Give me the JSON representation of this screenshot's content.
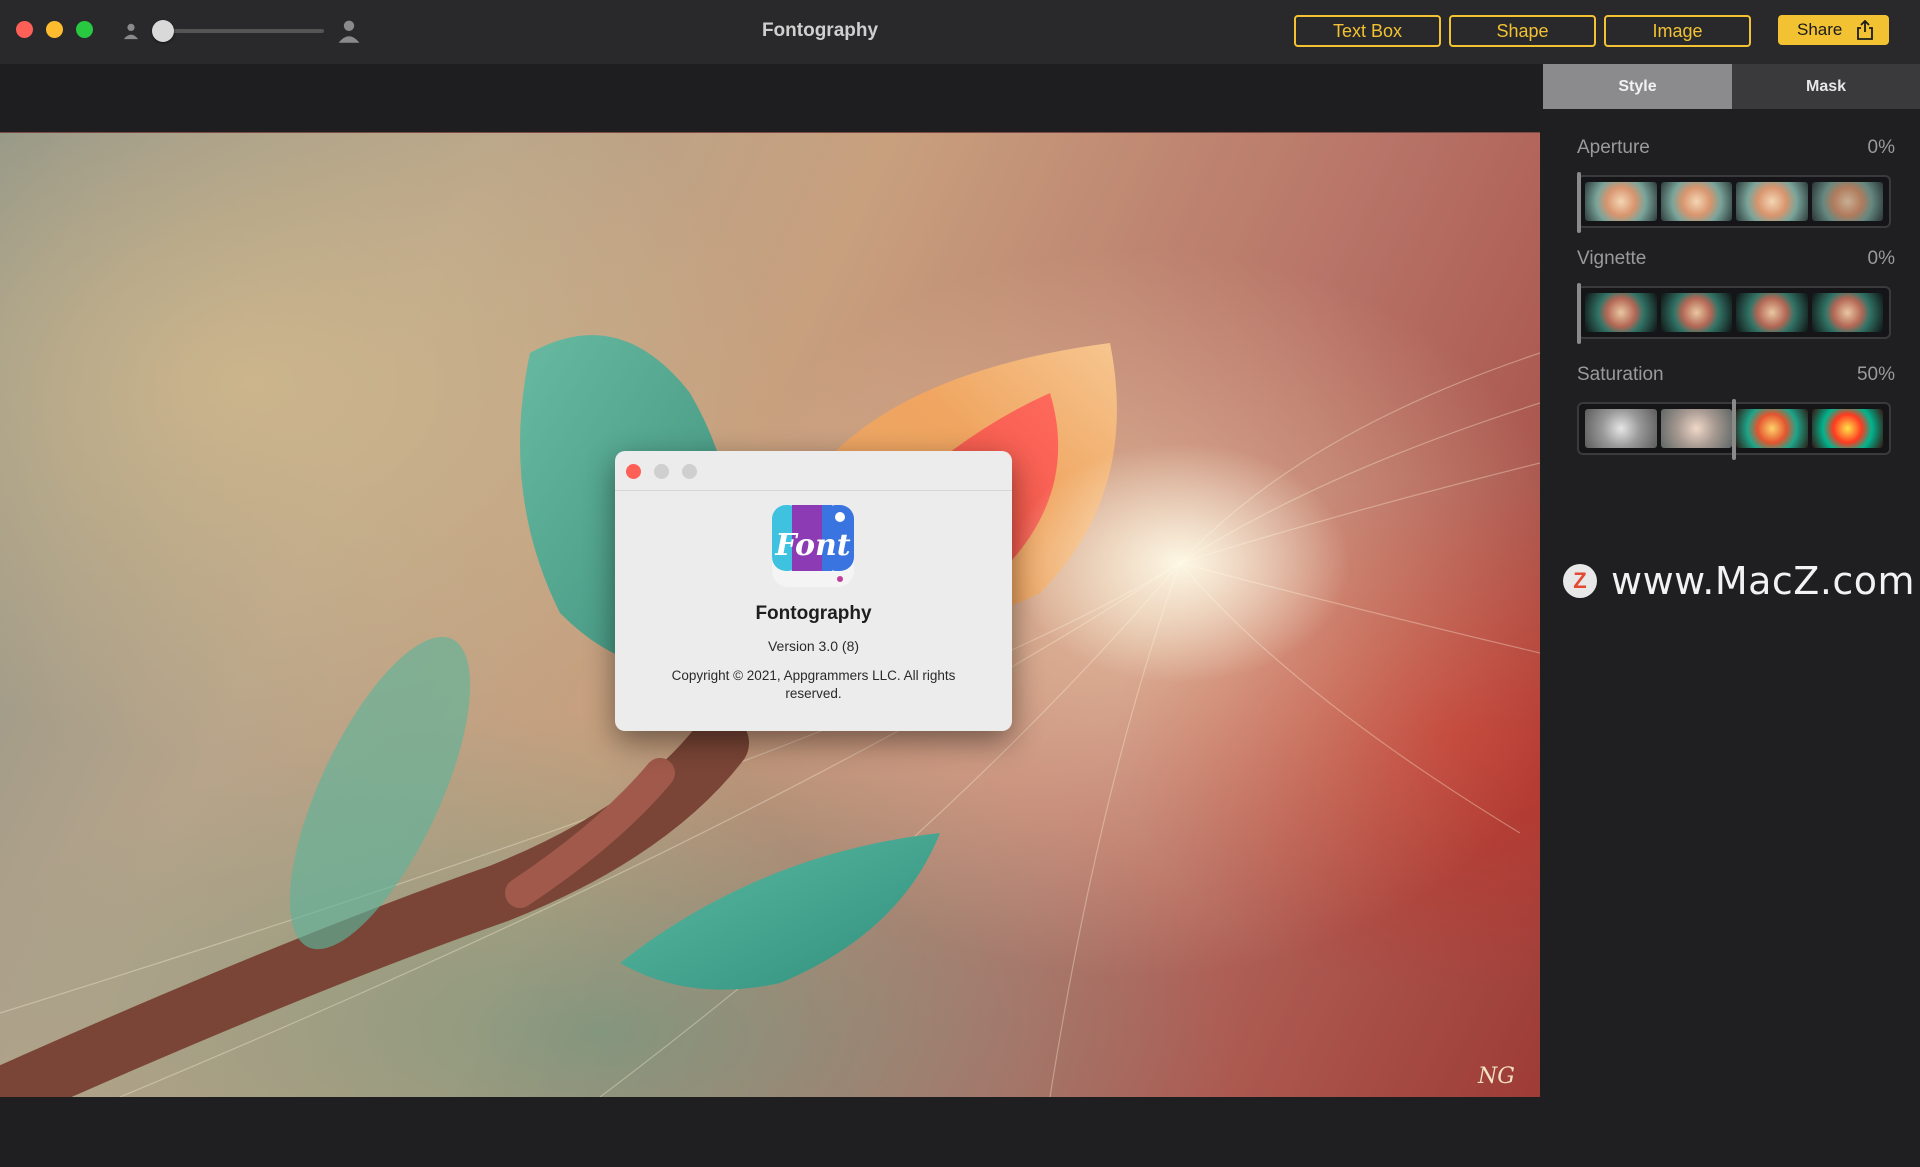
{
  "window": {
    "title": "Fontography"
  },
  "toolbar": {
    "buttons": [
      "Text Box",
      "Shape",
      "Image"
    ],
    "share_label": "Share",
    "zoom_slider_level": 0.0,
    "accent_color": "#f2c233"
  },
  "about": {
    "app_name": "Fontography",
    "version": "Version 3.0 (8)",
    "copyright": "Copyright © 2021, Appgrammers LLC. All rights reserved.",
    "icon_text": "Font"
  },
  "panel": {
    "tabs": [
      "Style",
      "Mask"
    ],
    "active_tab": "Style",
    "adjustments": [
      {
        "label": "Aperture",
        "value": "0%"
      },
      {
        "label": "Vignette",
        "value": "0%"
      },
      {
        "label": "Saturation",
        "value": "50%"
      }
    ]
  },
  "watermark": {
    "text": "www.MacZ.com",
    "logo_letter": "Z"
  },
  "photo": {
    "signature": "NG"
  }
}
